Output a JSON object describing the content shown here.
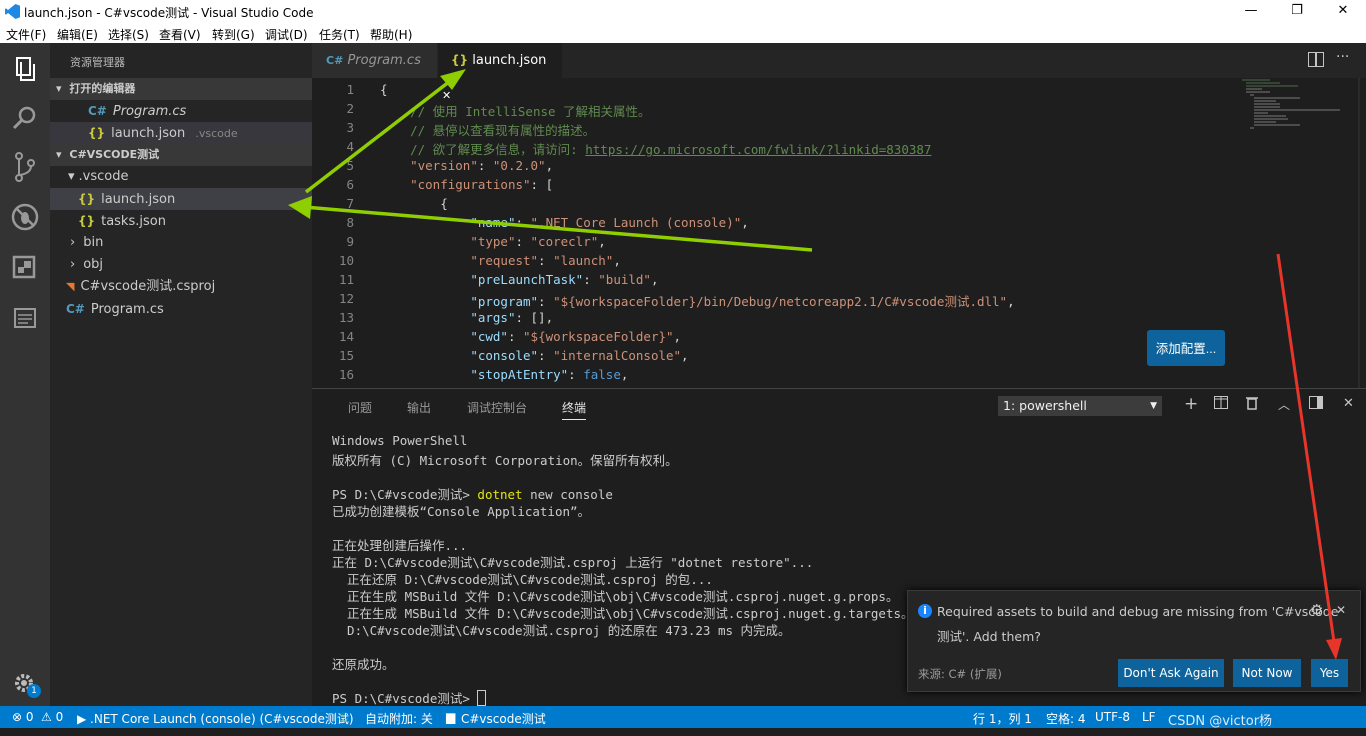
{
  "window": {
    "title": "launch.json - C#vscode测试 - Visual Studio Code",
    "min": "—",
    "max": "❐",
    "close": "✕"
  },
  "menu": [
    "文件(F)",
    "编辑(E)",
    "选择(S)",
    "查看(V)",
    "转到(G)",
    "调试(D)",
    "任务(T)",
    "帮助(H)"
  ],
  "activity": {
    "badge": "1",
    "icons": [
      "files-icon",
      "search-icon",
      "source-control-icon",
      "debug-icon",
      "extensions-icon",
      "output-icon",
      "settings-gear-icon"
    ]
  },
  "sidebar": {
    "title": "资源管理器",
    "open_editors": {
      "label": "打开的编辑器",
      "items": [
        {
          "name": "Program.cs",
          "icon": "C#",
          "path": ""
        },
        {
          "name": "launch.json",
          "icon": "{}",
          "path": ".vscode"
        }
      ]
    },
    "workspace": {
      "label": "C#VSCODE测试",
      "items": [
        {
          "name": ".vscode",
          "icon": "▾"
        },
        {
          "name": "launch.json",
          "icon": "{}"
        },
        {
          "name": "tasks.json",
          "icon": "{}"
        },
        {
          "name": "bin",
          "icon": "›"
        },
        {
          "name": "obj",
          "icon": "›"
        },
        {
          "name": "C#vscode测试.csproj",
          "icon": "rss"
        },
        {
          "name": "Program.cs",
          "icon": "C#"
        }
      ]
    }
  },
  "editor": {
    "tabs": [
      {
        "label": "Program.cs",
        "icon": "C#",
        "active": false
      },
      {
        "label": "launch.json",
        "icon": "{}",
        "active": true,
        "close": "✕"
      }
    ],
    "line_numbers": [
      "1",
      "2",
      "3",
      "4",
      "5",
      "6",
      "7",
      "8",
      "9",
      "10",
      "11",
      "12",
      "13",
      "14",
      "15",
      "16"
    ],
    "code": [
      [
        [
          "p",
          "{"
        ]
      ],
      [
        [
          "p",
          "    "
        ],
        [
          "c",
          "// 使用 IntelliSense 了解相关属性。"
        ]
      ],
      [
        [
          "p",
          "    "
        ],
        [
          "c",
          "// 悬停以查看现有属性的描述。"
        ]
      ],
      [
        [
          "p",
          "    "
        ],
        [
          "c",
          "// 欲了解更多信息，请访问: "
        ],
        [
          "l",
          "https://go.microsoft.com/fwlink/?linkid=830387"
        ]
      ],
      [
        [
          "p",
          "    "
        ],
        [
          "s",
          "\"version\""
        ],
        [
          "p",
          ": "
        ],
        [
          "s",
          "\"0.2.0\""
        ],
        [
          "p",
          ","
        ]
      ],
      [
        [
          "p",
          "    "
        ],
        [
          "s",
          "\"configurations\""
        ],
        [
          "p",
          ": ["
        ]
      ],
      [
        [
          "p",
          "        {"
        ]
      ],
      [
        [
          "p",
          "            "
        ],
        [
          "k",
          "\"name\""
        ],
        [
          "p",
          ": "
        ],
        [
          "s",
          "\".NET Core Launch (console)\""
        ],
        [
          "p",
          ","
        ]
      ],
      [
        [
          "p",
          "            "
        ],
        [
          "s",
          "\"type\""
        ],
        [
          "p",
          ": "
        ],
        [
          "s",
          "\"coreclr\""
        ],
        [
          "p",
          ","
        ]
      ],
      [
        [
          "p",
          "            "
        ],
        [
          "s",
          "\"request\""
        ],
        [
          "p",
          ": "
        ],
        [
          "s",
          "\"launch\""
        ],
        [
          "p",
          ","
        ]
      ],
      [
        [
          "p",
          "            "
        ],
        [
          "k",
          "\"preLaunchTask\""
        ],
        [
          "p",
          ": "
        ],
        [
          "s",
          "\"build\""
        ],
        [
          "p",
          ","
        ]
      ],
      [
        [
          "p",
          "            "
        ],
        [
          "k",
          "\"program\""
        ],
        [
          "p",
          ": "
        ],
        [
          "s",
          "\"${workspaceFolder}/bin/Debug/netcoreapp2.1/C#vscode测试.dll\""
        ],
        [
          "p",
          ","
        ]
      ],
      [
        [
          "p",
          "            "
        ],
        [
          "k",
          "\"args\""
        ],
        [
          "p",
          ": [],"
        ]
      ],
      [
        [
          "p",
          "            "
        ],
        [
          "k",
          "\"cwd\""
        ],
        [
          "p",
          ": "
        ],
        [
          "s",
          "\"${workspaceFolder}\""
        ],
        [
          "p",
          ","
        ]
      ],
      [
        [
          "p",
          "            "
        ],
        [
          "k",
          "\"console\""
        ],
        [
          "p",
          ": "
        ],
        [
          "s",
          "\"internalConsole\""
        ],
        [
          "p",
          ","
        ]
      ],
      [
        [
          "p",
          "            "
        ],
        [
          "k",
          "\"stopAtEntry\""
        ],
        [
          "p",
          ": "
        ],
        [
          "b",
          "false"
        ],
        [
          "p",
          ","
        ]
      ]
    ],
    "add_config_button": "添加配置..."
  },
  "panel": {
    "tabs": [
      "问题",
      "输出",
      "调试控制台",
      "终端"
    ],
    "active_tab": "终端",
    "terminal_select": "1: powershell",
    "icons": [
      "plus-icon",
      "split-icon",
      "trash-icon",
      "chevron-up-icon",
      "maximize-icon",
      "close-icon"
    ],
    "lines": [
      [
        [
          "n",
          "Windows PowerShell"
        ]
      ],
      [
        [
          "n",
          "版权所有 (C) Microsoft Corporation。保留所有权利。"
        ]
      ],
      [
        [
          "n",
          ""
        ]
      ],
      [
        [
          "n",
          "PS D:\\C#vscode测试> "
        ],
        [
          "y",
          "dotnet"
        ],
        [
          "n",
          " new console"
        ]
      ],
      [
        [
          "n",
          "已成功创建模板“Console Application”。"
        ]
      ],
      [
        [
          "n",
          ""
        ]
      ],
      [
        [
          "n",
          "正在处理创建后操作..."
        ]
      ],
      [
        [
          "n",
          "正在 D:\\C#vscode测试\\C#vscode测试.csproj 上运行 \"dotnet restore\"..."
        ]
      ],
      [
        [
          "n",
          "  正在还原 D:\\C#vscode测试\\C#vscode测试.csproj 的包..."
        ]
      ],
      [
        [
          "n",
          "  正在生成 MSBuild 文件 D:\\C#vscode测试\\obj\\C#vscode测试.csproj.nuget.g.props。"
        ]
      ],
      [
        [
          "n",
          "  正在生成 MSBuild 文件 D:\\C#vscode测试\\obj\\C#vscode测试.csproj.nuget.g.targets。"
        ]
      ],
      [
        [
          "n",
          "  D:\\C#vscode测试\\C#vscode测试.csproj 的还原在 473.23 ms 内完成。"
        ]
      ],
      [
        [
          "n",
          ""
        ]
      ],
      [
        [
          "n",
          "还原成功。"
        ]
      ],
      [
        [
          "n",
          ""
        ]
      ],
      [
        [
          "n",
          "PS D:\\C#vscode测试> "
        ]
      ]
    ]
  },
  "notification": {
    "message_line1": "Required assets to build and debug are missing from 'C#vscode",
    "message_line2": "测试'. Add them?",
    "source": "来源: C# (扩展)",
    "buttons": [
      "Don't Ask Again",
      "Not Now",
      "Yes"
    ]
  },
  "status": {
    "errors": "⊗ 0",
    "warnings": "⚠ 0",
    "debug": "▶ .NET Core Launch (console) (C#vscode测试)",
    "auto_attach": "自动附加: 关",
    "folder": "C#vscode测试",
    "position": "行 1，列 1",
    "spaces": "空格: 4",
    "encoding": "UTF-8",
    "eol": "LF",
    "watermark": "CSDN @victor杨"
  },
  "colors": {
    "accent": "#007acc",
    "button": "#0e639c",
    "annotation_green": "#8fce00",
    "annotation_red": "#e8352a"
  }
}
